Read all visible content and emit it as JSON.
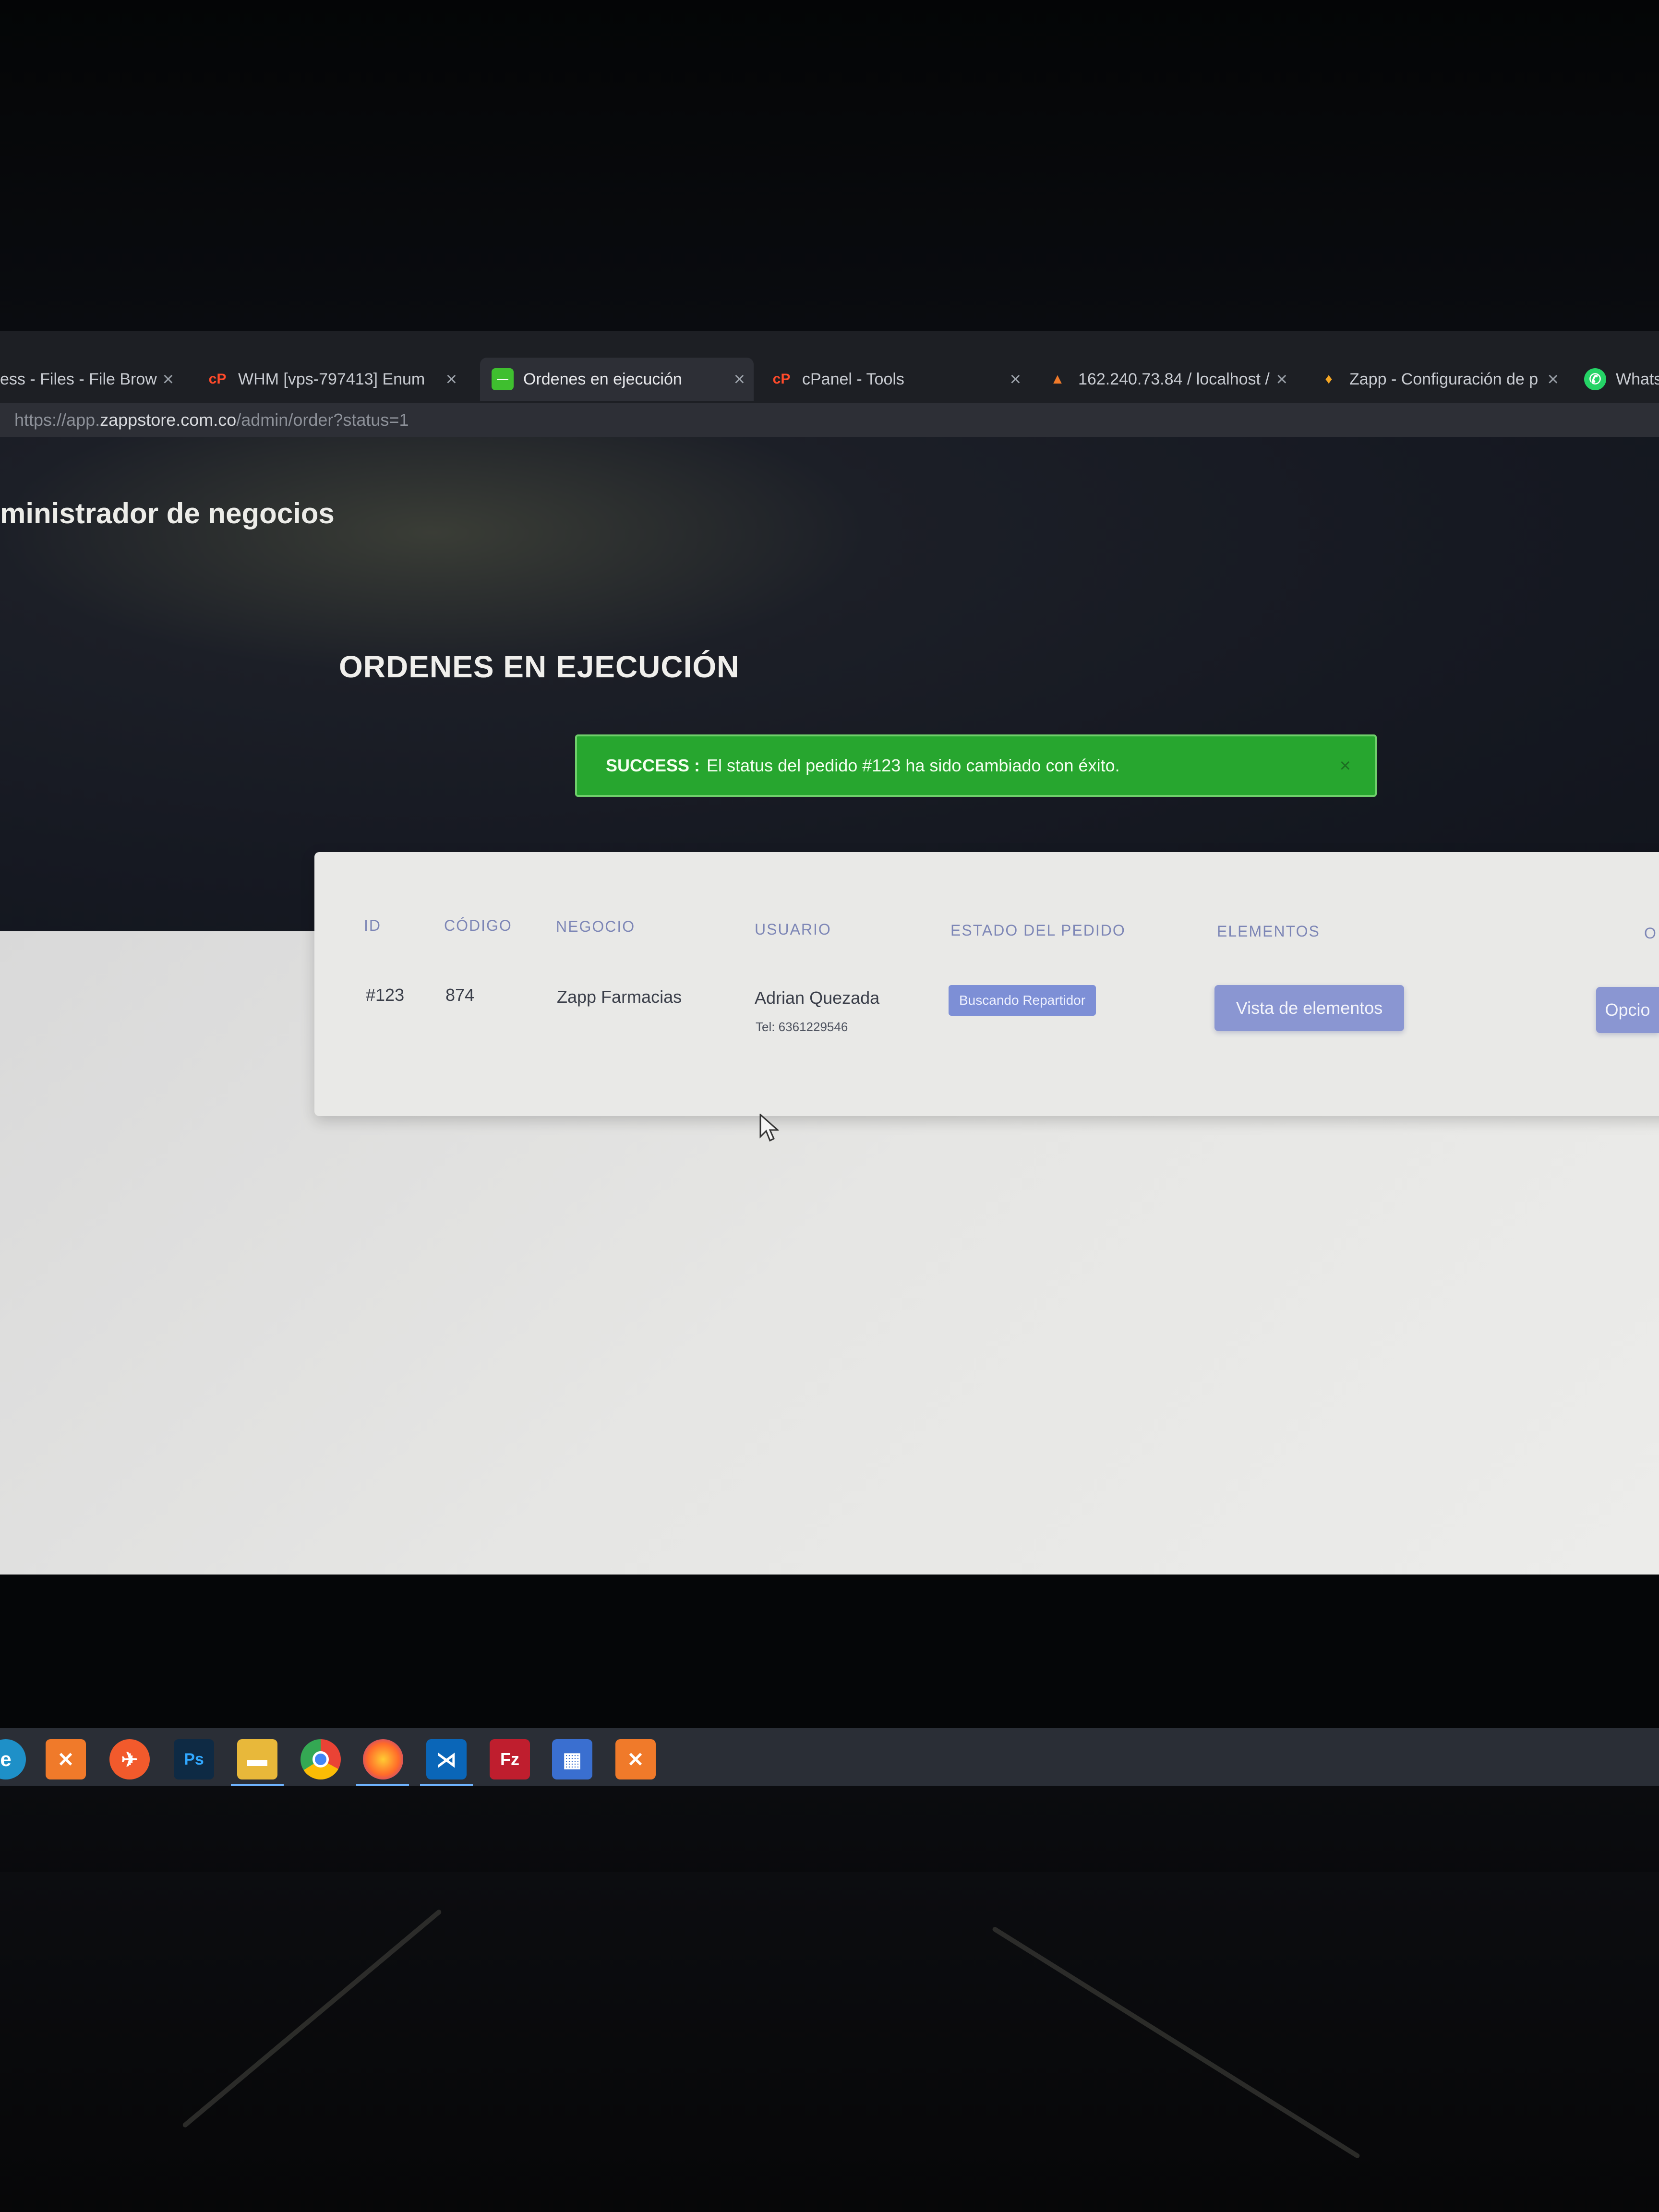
{
  "browser": {
    "tabs": [
      {
        "title": "ess - Files - File Brow",
        "icon": "file-manager-icon"
      },
      {
        "title": "WHM [vps-797413] Enum",
        "icon": "cpanel-icon"
      },
      {
        "title": "Ordenes en ejecución",
        "icon": "zapp-favicon"
      },
      {
        "title": "cPanel - Tools",
        "icon": "cpanel-icon"
      },
      {
        "title": "162.240.73.84 / localhost /",
        "icon": "phpmyadmin-icon"
      },
      {
        "title": "Zapp - Configuración de p",
        "icon": "firebase-icon"
      },
      {
        "title": "Whats",
        "icon": "whatsapp-icon"
      }
    ],
    "url_prefix": "https://app.",
    "url_host": "zappstore.com.co",
    "url_path": "/admin/order?status=1"
  },
  "header": {
    "brand": "ministrador de negocios"
  },
  "main": {
    "title": "ORDENES EN EJECUCIÓN",
    "alert": {
      "label": "SUCCESS :",
      "message": "El status del pedido #123 ha sido cambiado con éxito.",
      "close": "×"
    },
    "table": {
      "headers": [
        "ID",
        "CÓDIGO",
        "NEGOCIO",
        "USUARIO",
        "ESTADO DEL PEDIDO",
        "ELEMENTOS",
        "O"
      ],
      "rows": [
        {
          "id": "#123",
          "code": "874",
          "business": "Zapp Farmacias",
          "user_name": "Adrian Quezada",
          "user_phone": "Tel: 6361229546",
          "status": "Buscando Repartidor",
          "elements_button": "Vista de elementos",
          "options_button": "Opcio"
        }
      ]
    }
  },
  "taskbar": {
    "icons": [
      "edge-icon",
      "xampp-icon",
      "postman-icon",
      "photoshop-icon",
      "file-explorer-icon",
      "chrome-icon",
      "firefox-icon",
      "vscode-icon",
      "filezilla-icon",
      "store-icon",
      "xampp-icon"
    ],
    "labels": {
      "photoshop": "Ps",
      "filezilla": "Fz"
    }
  },
  "colors": {
    "alert_success": "#27a62f",
    "badge": "#7d8fd6",
    "button": "#8a96d2",
    "header_text": "#7d86b6"
  }
}
